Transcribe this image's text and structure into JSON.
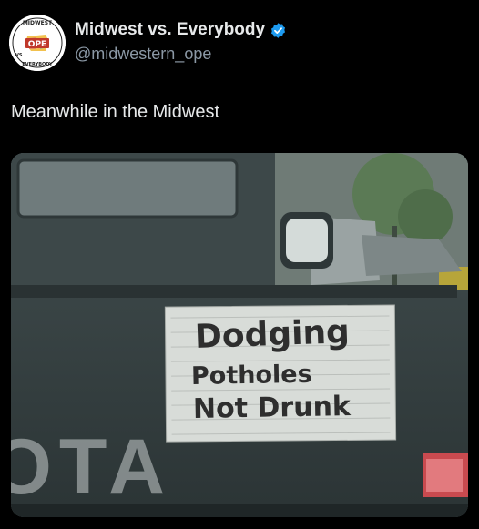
{
  "post": {
    "author": {
      "display_name": "Midwest vs. Everybody",
      "handle": "@midwestern_ope",
      "verified": true,
      "avatar": {
        "top_text": "MIDWEST",
        "center_text": "OPE",
        "bottom_text": "EVERYBODY",
        "vs_text": "VS"
      }
    },
    "text": "Meanwhile in the Midwest",
    "media": {
      "sign": {
        "line1": "Dodging",
        "line2": "Potholes",
        "line3": "Not Drunk"
      },
      "tailgate_brand": "OTA"
    }
  },
  "colors": {
    "background": "#000000",
    "text": "#e7e9ea",
    "secondary_text": "#8b98a5",
    "verified_badge": "#1d9bf0"
  },
  "icons": [
    "avatar-logo",
    "verified-badge-icon"
  ]
}
